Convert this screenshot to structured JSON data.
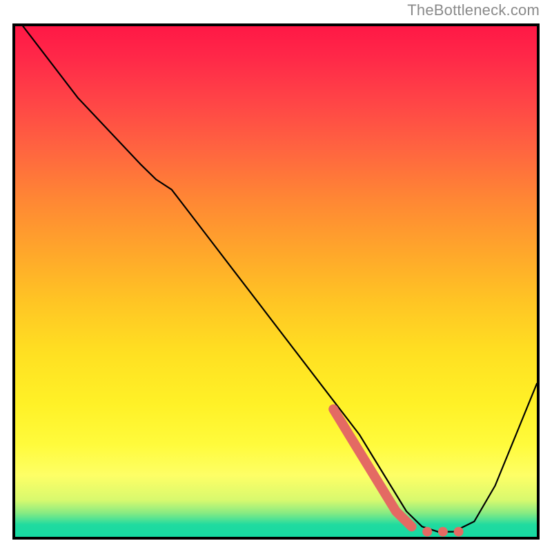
{
  "attribution": "TheBottleneck.com",
  "colors": {
    "curve": "#000000",
    "highlight": "#e46a63",
    "frame": "#000000"
  },
  "chart_data": {
    "type": "line",
    "title": "",
    "xlabel": "",
    "ylabel": "",
    "xlim": [
      0,
      100
    ],
    "ylim": [
      0,
      100
    ],
    "grid": false,
    "legend": false,
    "series": [
      {
        "name": "bottleneck_curve",
        "x": [
          0,
          6,
          12,
          18,
          24,
          27,
          30,
          36,
          42,
          48,
          54,
          60,
          66,
          69,
          72,
          75,
          78,
          81,
          84,
          88,
          92,
          96,
          100
        ],
        "y": [
          102,
          94,
          86,
          79.5,
          73,
          70,
          68,
          60,
          52,
          44,
          36,
          28,
          20,
          15,
          10,
          5,
          2,
          1,
          1,
          3,
          10,
          20,
          30
        ]
      }
    ],
    "highlight": {
      "name": "highlighted_range",
      "x": [
        61,
        64,
        67,
        70,
        73,
        76
      ],
      "y": [
        25,
        20,
        15,
        10,
        5,
        2
      ]
    },
    "highlight_dots": {
      "x": [
        79,
        82,
        85
      ],
      "y": [
        1,
        1,
        1
      ]
    },
    "background_gradient": {
      "stops": [
        {
          "pos": 0.0,
          "color": "#ff1846"
        },
        {
          "pos": 0.5,
          "color": "#ffc524"
        },
        {
          "pos": 0.88,
          "color": "#feff66"
        },
        {
          "pos": 1.0,
          "color": "#16d9a3"
        }
      ]
    }
  }
}
